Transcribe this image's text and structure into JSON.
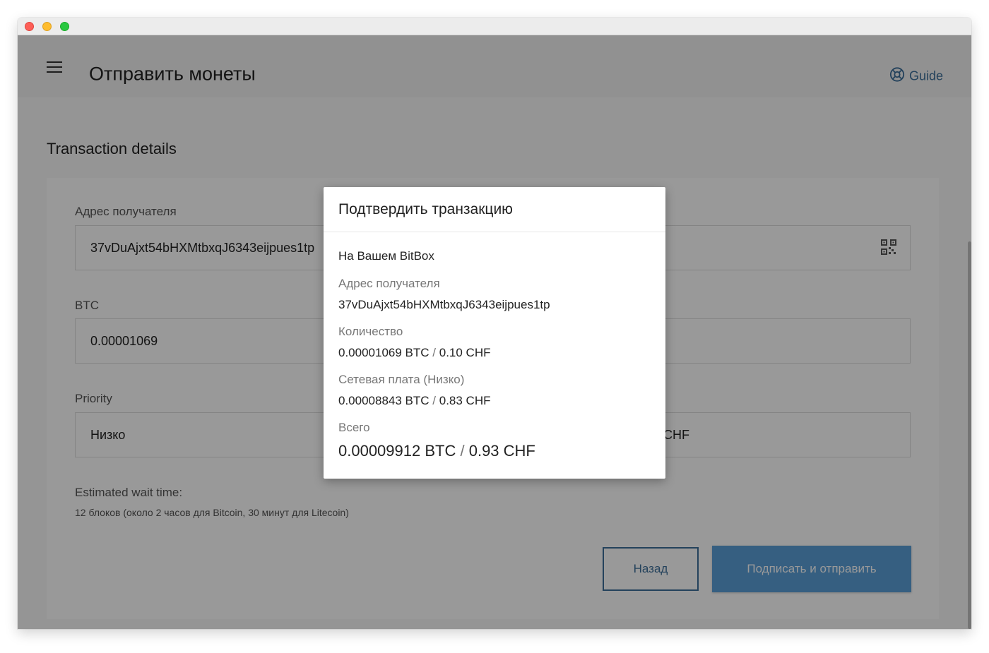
{
  "header": {
    "title": "Отправить монеты",
    "guide_label": "Guide"
  },
  "section": {
    "title": "Transaction details"
  },
  "form": {
    "recipient_label": "Адрес получателя",
    "recipient_value": "37vDuAjxt54bHXMtbxqJ6343eijpues1tp",
    "amount_label": "BTC",
    "amount_value": "0.00001069",
    "priority_label": "Priority",
    "priority_value": "Низко",
    "fee_partial": "CHF",
    "wait_label": "Estimated wait time:",
    "wait_value": "12 блоков (около 2 часов для Bitcoin, 30 минут для Litecoin)"
  },
  "buttons": {
    "back": "Назад",
    "sign": "Подписать и отправить"
  },
  "modal": {
    "title": "Подтвердить транзакцию",
    "device": "На Вашем BitBox",
    "recipient_label": "Адрес получателя",
    "recipient": "37vDuAjxt54bHXMtbxqJ6343eijpues1tp",
    "amount_label": "Количество",
    "amount_btc": "0.00001069 BTC",
    "amount_fiat": "0.10 CHF",
    "fee_label": "Сетевая плата (Низко)",
    "fee_btc": "0.00008843 BTC",
    "fee_fiat": "0.83 CHF",
    "total_label": "Всего",
    "total_btc": "0.00009912 BTC",
    "total_fiat": "0.93 CHF",
    "separator": "/"
  },
  "icons": [
    "menu-icon",
    "lifebuoy-icon",
    "qr-code-icon"
  ],
  "colors": {
    "accent": "#3d6f99",
    "primary_button": "#5a9fd8",
    "overlay": "rgba(0,0,0,0.40)"
  }
}
